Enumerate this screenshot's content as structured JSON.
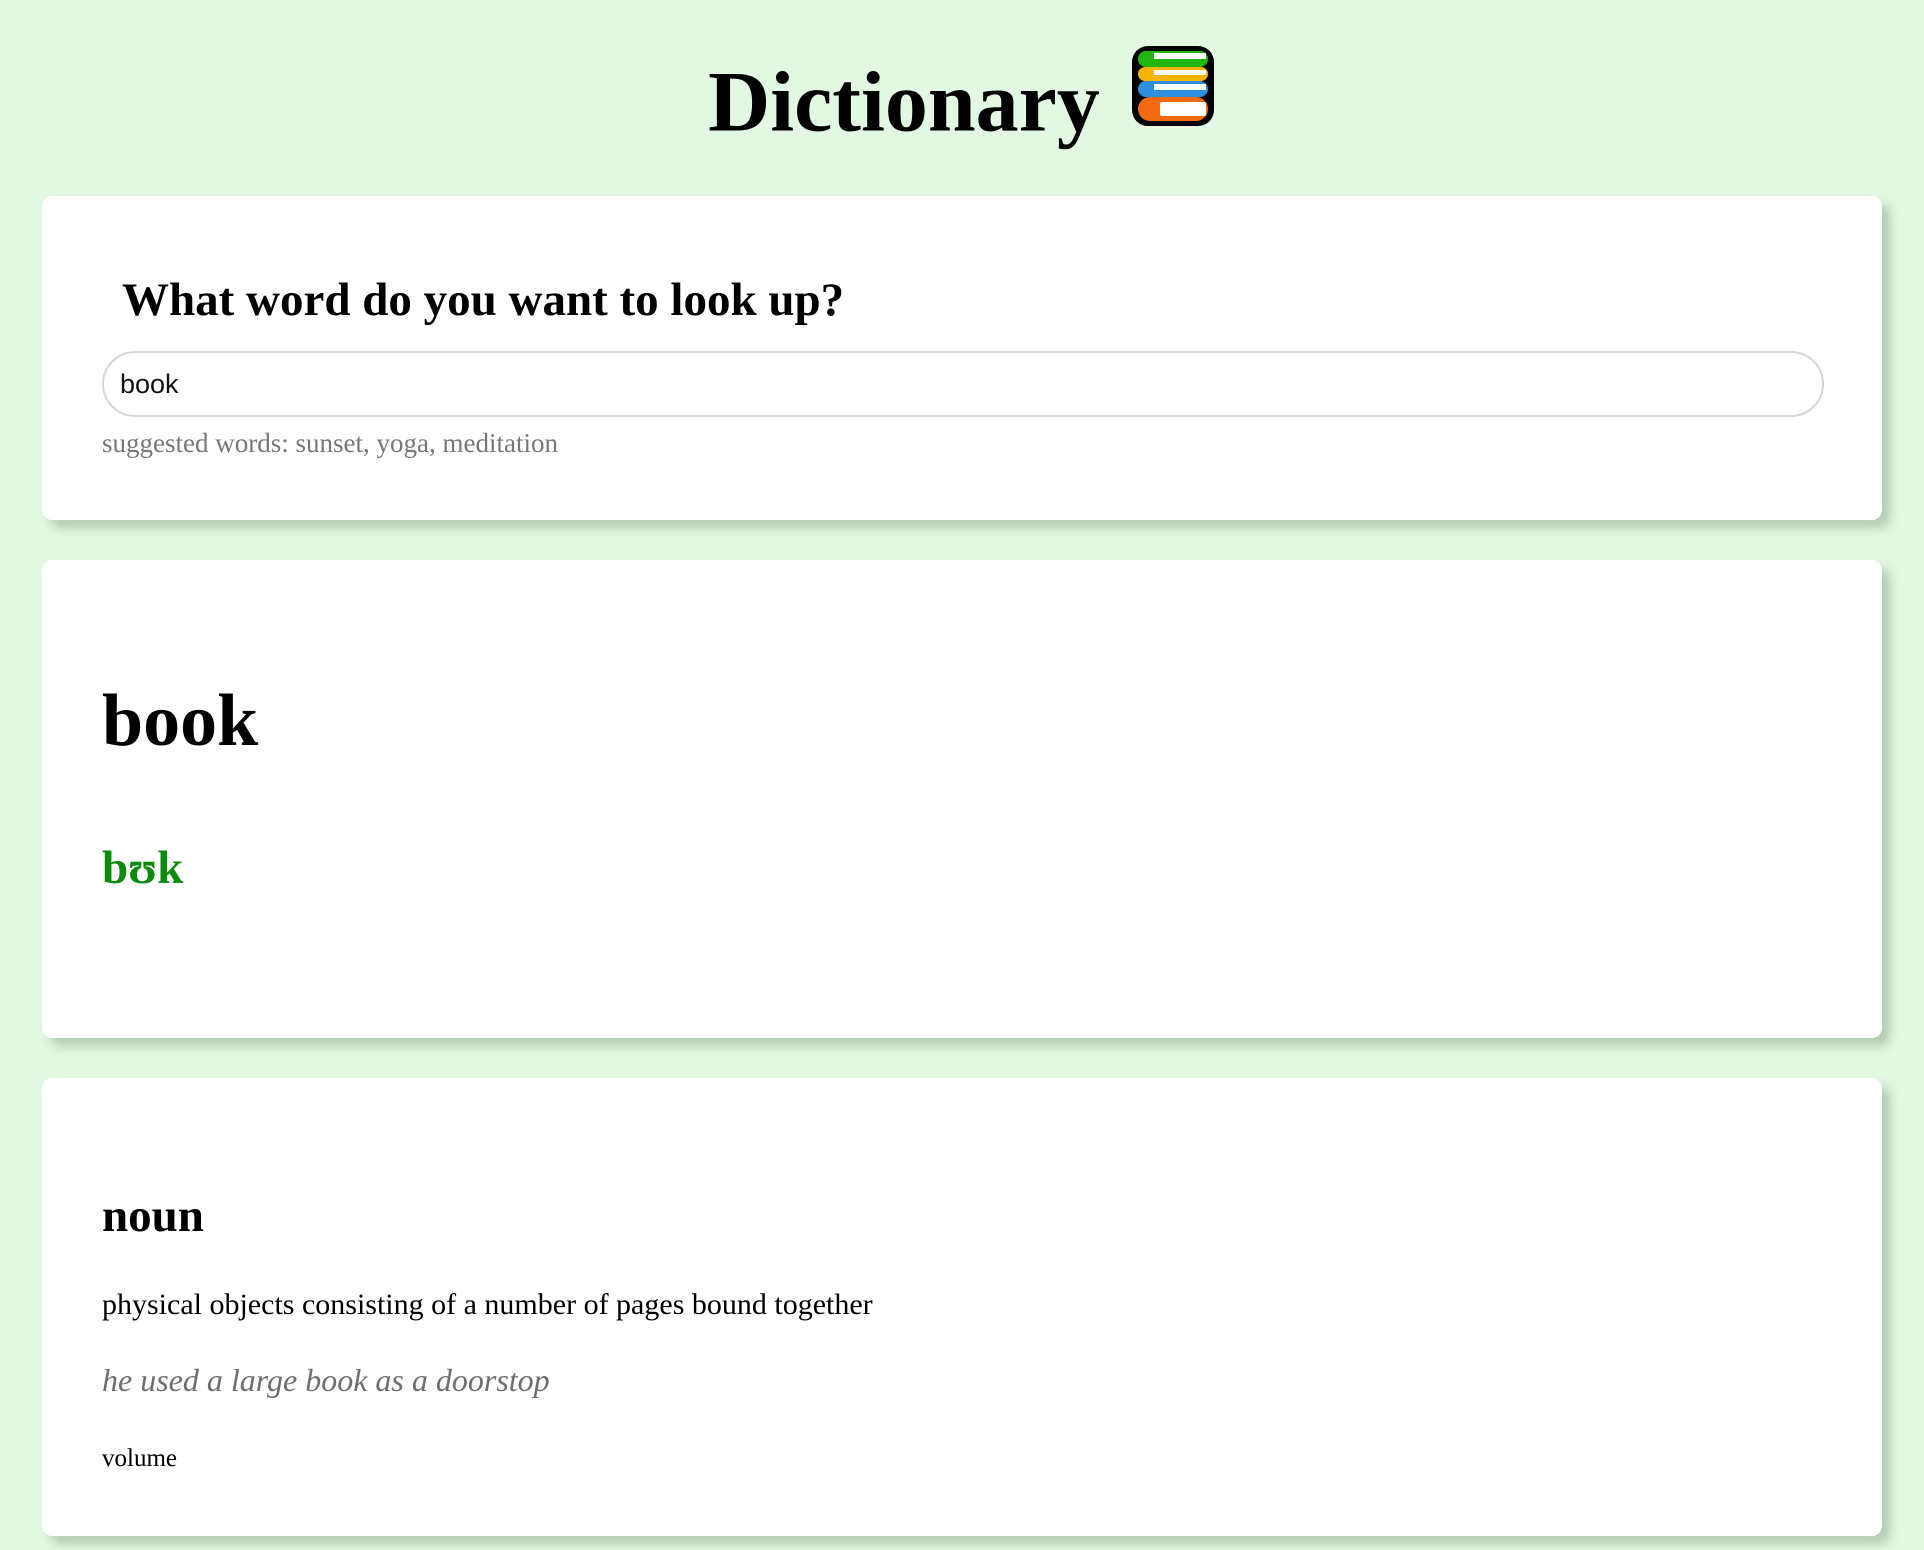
{
  "header": {
    "title": "Dictionary",
    "icon": "books-icon"
  },
  "search": {
    "heading": "What word do you want to look up?",
    "value": "book",
    "suggested": "suggested words: sunset, yoga, meditation"
  },
  "result": {
    "word": "book",
    "phonetic": "bʊk"
  },
  "meaning": {
    "part_of_speech": "noun",
    "definition": "physical objects consisting of a number of pages bound together",
    "example": "he used a large book as a doorstop",
    "synonym": "volume"
  },
  "colors": {
    "background": "#e3f8e3",
    "card": "#ffffff",
    "phonetic": "#0b8a0b",
    "muted": "#777777"
  }
}
